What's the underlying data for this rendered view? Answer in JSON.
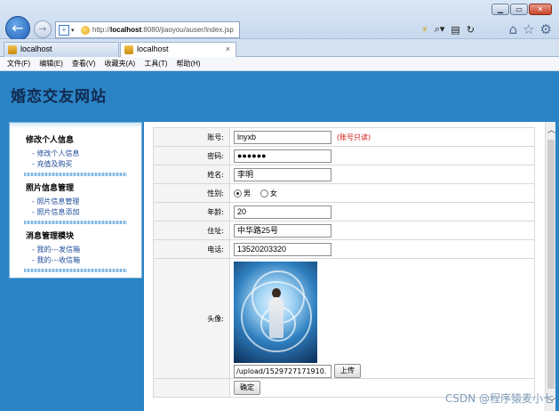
{
  "browser": {
    "window_buttons": [
      "▁",
      "▭",
      "✕"
    ],
    "address": {
      "prefix": "http://",
      "host": "localhost",
      "rest": ":8080/jiaoyou/auser/index.jsp"
    },
    "tabs": [
      {
        "label": "localhost"
      },
      {
        "label": "localhost",
        "close": "×"
      }
    ],
    "menu": [
      "文件(F)",
      "编辑(E)",
      "查看(V)",
      "收藏夹(A)",
      "工具(T)",
      "帮助(H)"
    ]
  },
  "site": {
    "title": "婚恋交友网站"
  },
  "sidebar": {
    "groups": [
      {
        "title": "修改个人信息",
        "links": [
          "修改个人信息",
          "充值及购买"
        ]
      },
      {
        "title": "照片信息管理",
        "links": [
          "照片信息管理",
          "照片信息添加"
        ]
      },
      {
        "title": "消息管理模块",
        "links": [
          "我的---发信箱",
          "我的---收信箱"
        ]
      }
    ]
  },
  "form": {
    "account": {
      "label": "账号:",
      "value": "lnyxb",
      "hint": "(账号只读)"
    },
    "password": {
      "label": "密码:",
      "value": "●●●●●●"
    },
    "name": {
      "label": "姓名:",
      "value": "李明"
    },
    "gender": {
      "label": "性别:",
      "options": [
        "男",
        "女"
      ],
      "selected": "男"
    },
    "age": {
      "label": "年龄:",
      "value": "20"
    },
    "address": {
      "label": "住址:",
      "value": "中华路25号"
    },
    "phone": {
      "label": "电话:",
      "value": "13520203320"
    },
    "avatar": {
      "label": "头像:",
      "file_value": "/upload/1529727171910.",
      "upload_label": "上传"
    },
    "submit_label": "确定"
  },
  "watermark": "CSDN @程序猿麦小七"
}
